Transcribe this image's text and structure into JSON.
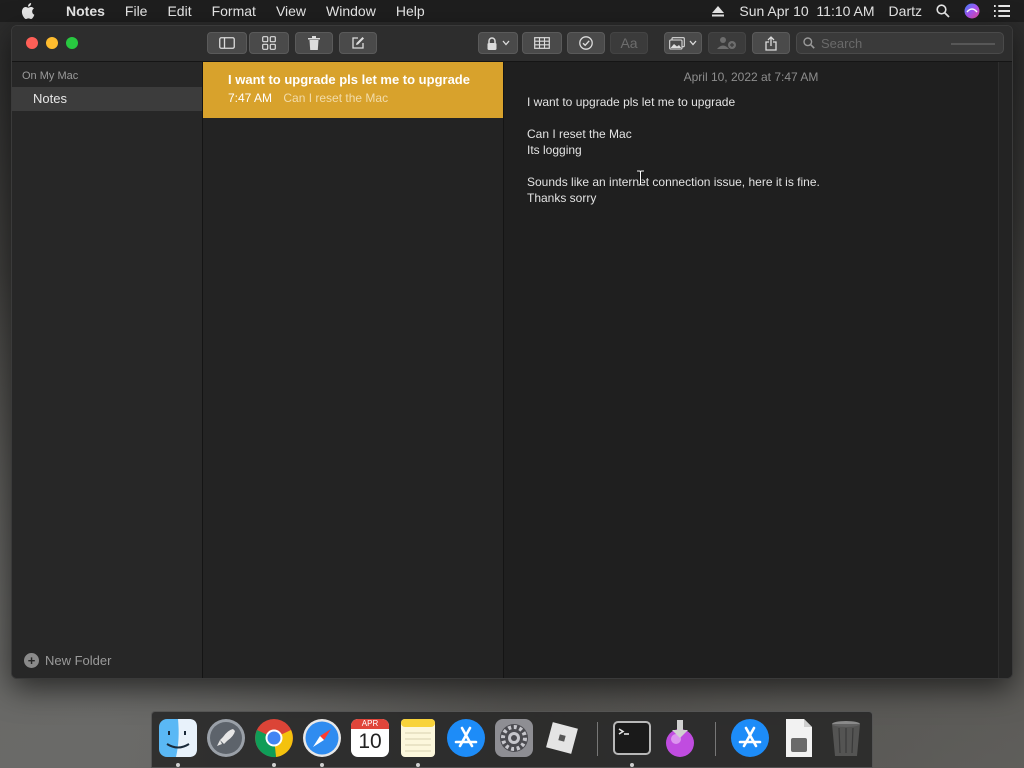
{
  "menubar": {
    "app_name": "Notes",
    "menus": [
      "File",
      "Edit",
      "Format",
      "View",
      "Window",
      "Help"
    ],
    "datetime": "Sun Apr 10  11:10 AM",
    "user": "Dartz"
  },
  "toolbar": {
    "search_placeholder": "Search",
    "format_label": "Aa"
  },
  "sidebar": {
    "section_title": "On My Mac",
    "folders": [
      "Notes"
    ],
    "new_folder_label": "New Folder"
  },
  "notes": [
    {
      "title": "I want to upgrade pls let me to upgrade",
      "time": "7:47 AM",
      "preview": "Can I reset the Mac"
    }
  ],
  "editor": {
    "date": "April 10, 2022 at 7:47 AM",
    "lines": [
      "I want to upgrade pls let me to upgrade",
      "",
      "Can I reset the Mac",
      "Its logging",
      "",
      "Sounds like an internet connection issue, here it is fine.",
      "Thanks sorry"
    ]
  },
  "dock": {
    "calendar_month": "APR",
    "calendar_day": "10",
    "apps": [
      "finder",
      "launchpad",
      "chrome",
      "safari",
      "calendar",
      "notes",
      "app-store",
      "system-preferences",
      "roblox",
      "terminal",
      "installer",
      "app-store-2",
      "preview",
      "trash"
    ]
  },
  "colors": {
    "selected_note": "#d8a22c",
    "window_bg": "#232323",
    "editor_bg": "#1f1f1f"
  }
}
